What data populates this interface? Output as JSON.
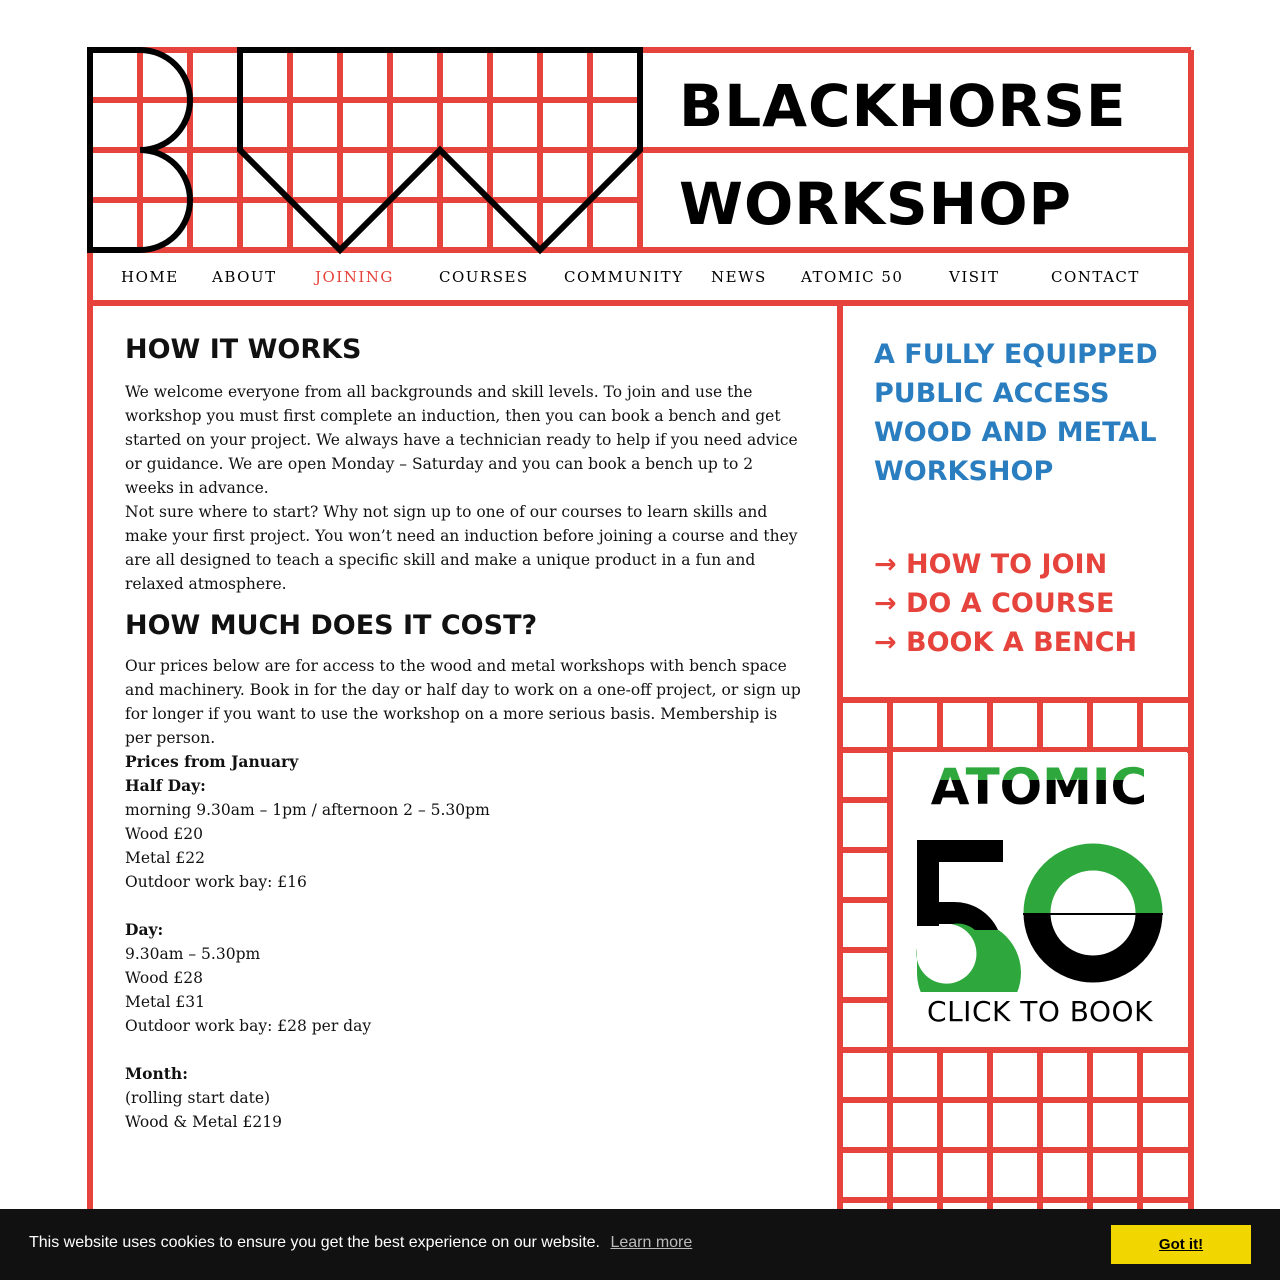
{
  "brand": {
    "line1": "BLACKHORSE",
    "line2": "WORKSHOP"
  },
  "nav": {
    "items": [
      "HOME",
      "ABOUT",
      "JOINING",
      "COURSES",
      "COMMUNITY",
      "NEWS",
      "ATOMIC 50",
      "VISIT",
      "CONTACT"
    ],
    "active": "JOINING"
  },
  "main": {
    "heading1": "HOW IT WORKS",
    "intro": "We welcome everyone from all backgrounds and skill levels. To join and use the workshop you must first complete an induction, then you can book a bench and get started on your project. We always have a technician ready to help if you need advice or guidance. We are open Monday – Saturday and you can book a bench up to 2 weeks in advance.",
    "courses_para": "Not sure where to start? Why not sign up to one of our courses to learn skills and make your first project. You won’t need an induction before joining a course and they are all designed to teach a specific skill and make a unique product in a fun and relaxed atmosphere.",
    "heading2": "HOW MUCH DOES IT COST?",
    "prices_intro": "Our prices below are for access to the wood and metal workshops with bench space and machinery. Book in for the day or half day to work on a one-off project, or sign up for longer if you want to use the workshop on a more serious basis. Membership is per person.",
    "prices_from": "Prices from January",
    "half_day": {
      "title": "Half Day:",
      "lines": [
        "morning 9.30am – 1pm / afternoon 2 – 5.30pm",
        "Wood £20",
        "Metal £22",
        "Outdoor work bay: £16"
      ]
    },
    "day": {
      "title": "Day:",
      "lines": [
        "9.30am – 5.30pm",
        "Wood £28",
        "Metal £31",
        "Outdoor work bay: £28 per day"
      ]
    },
    "month": {
      "title": "Month:",
      "lines": [
        "(rolling start date)",
        "Wood & Metal £219"
      ]
    }
  },
  "sidebar": {
    "tagline": [
      "A FULLY EQUIPPED",
      "PUBLIC ACCESS",
      "WOOD AND METAL",
      "WORKSHOP"
    ],
    "ctas": [
      "→ HOW TO JOIN",
      "→ DO A COURSE",
      "→ BOOK A BENCH"
    ],
    "atomic": {
      "word": "ATOMIC",
      "number": "50",
      "book_label": "CLICK TO BOOK"
    }
  },
  "cookie": {
    "message": "This website uses cookies to ensure you get the best experience on our website.",
    "learn_more": "Learn more",
    "button": "Got it!"
  },
  "colors": {
    "grid_red": "#e5433b",
    "tagline_blue": "#2a7dbf",
    "atomic_green": "#2ea83c",
    "cookie_button": "#f1d600"
  }
}
